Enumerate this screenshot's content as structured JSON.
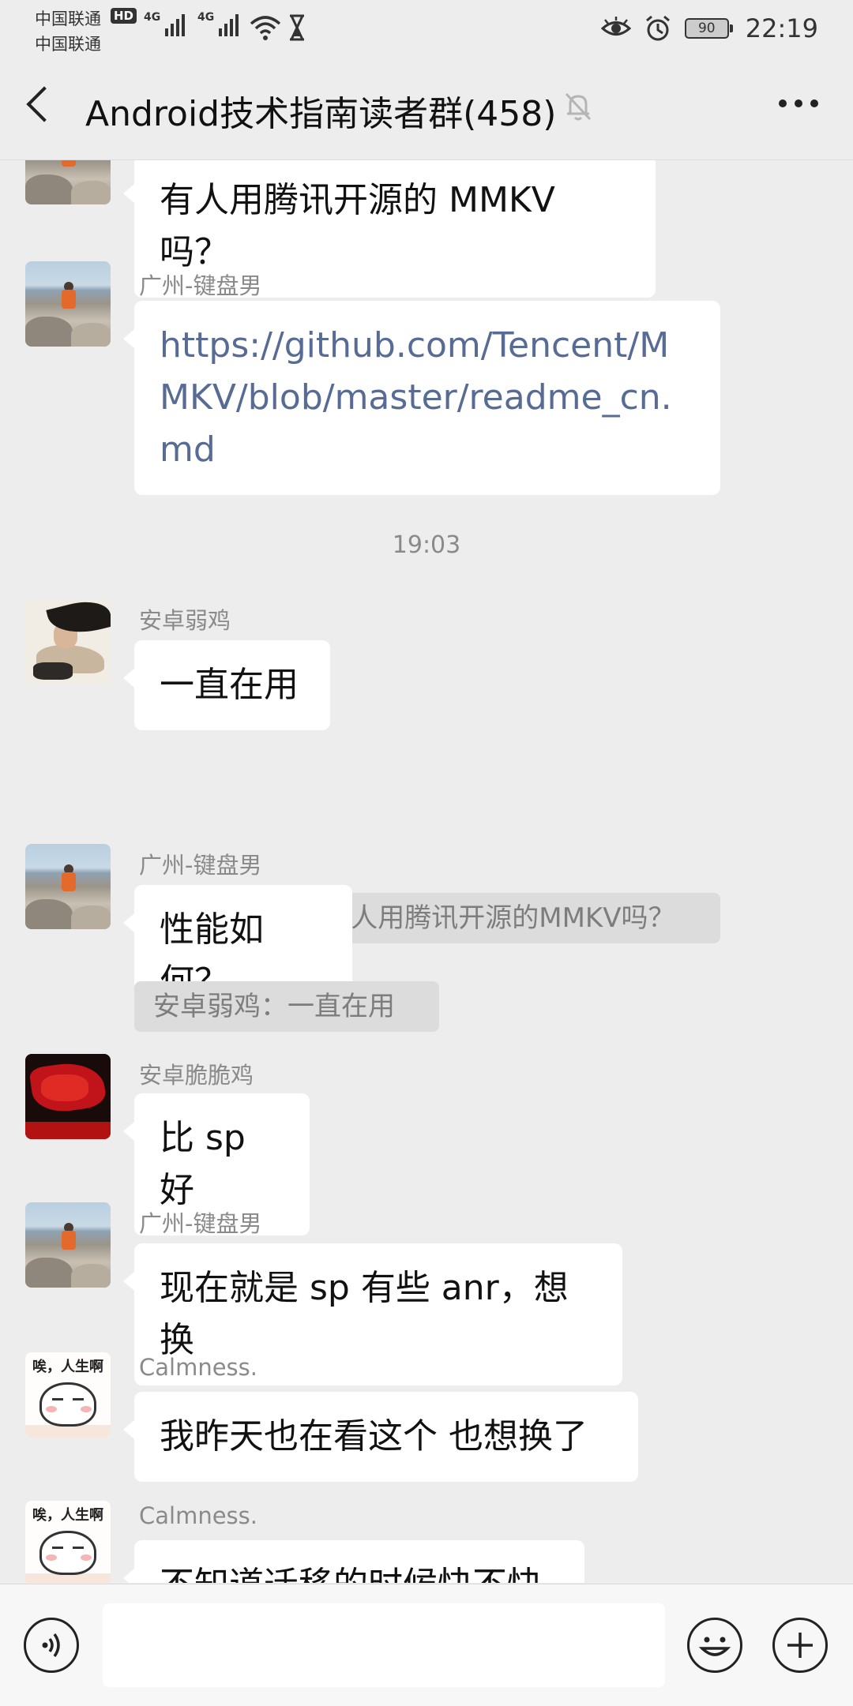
{
  "status_bar": {
    "carrier_1": "中国联通",
    "carrier_2": "中国联通",
    "hd_badge": "HD",
    "network_1": "4G",
    "network_2": "4G",
    "battery": "90",
    "time": "22:19"
  },
  "header": {
    "title": "Android技术指南读者群(458)"
  },
  "messages": [
    {
      "sender": "",
      "text": "有人用腾讯开源的 MMKV 吗？"
    },
    {
      "sender": "广州-键盘男",
      "text": "https://github.com/Tencent/MMKV/blob/master/readme_cn.md"
    },
    {
      "sender": "安卓弱鸡",
      "text": "一直在用",
      "quote": "广州-键盘男：有人用腾讯开源的MMKV吗？"
    },
    {
      "sender": "广州-键盘男",
      "text": "性能如何？",
      "quote": "安卓弱鸡：一直在用"
    },
    {
      "sender": "安卓脆脆鸡",
      "text": "比 sp 好"
    },
    {
      "sender": "广州-键盘男",
      "text": "现在就是 sp 有些 anr，想换"
    },
    {
      "sender": "Calmness.",
      "text": "我昨天也在看这个  也想换了"
    },
    {
      "sender": "Calmness.",
      "text": "不知道迁移的时候快不快"
    }
  ],
  "timestamp": "19:03",
  "avatar_caption": "唉，人生啊",
  "input": {
    "value": ""
  },
  "colors": {
    "background": "#ededed",
    "bubble": "#ffffff",
    "link": "#576b95",
    "quote_bg": "#dcdcdc"
  }
}
